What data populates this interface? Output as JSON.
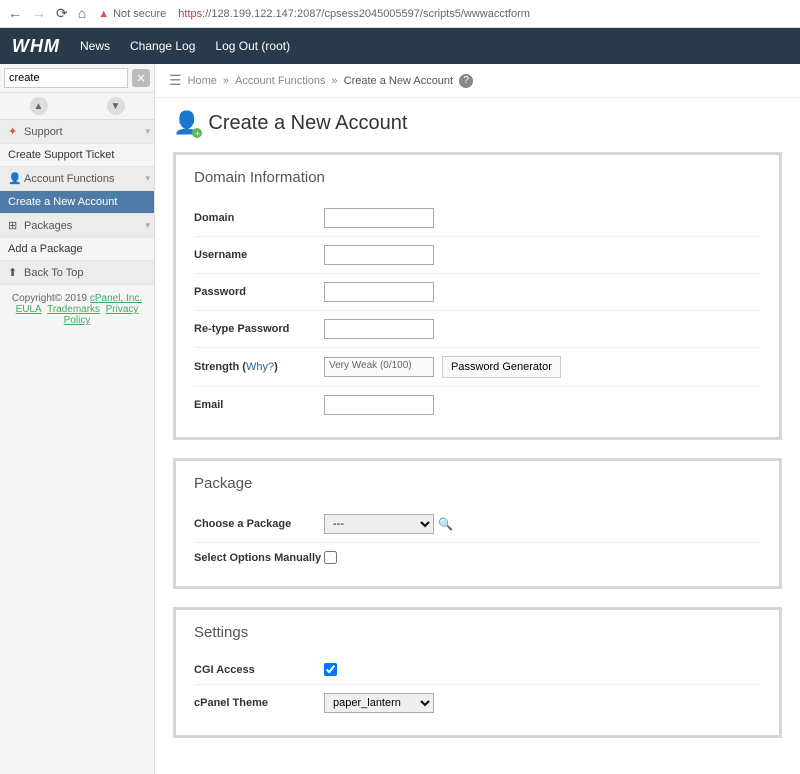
{
  "browser": {
    "not_secure": "Not secure",
    "scheme": "https",
    "url_rest": "://128.199.122.147:2087/cpsess2045005597/scripts5/wwwacctform"
  },
  "topnav": {
    "logo": "WHM",
    "news": "News",
    "changelog": "Change Log",
    "logout": "Log Out (root)"
  },
  "sidebar": {
    "search": "create",
    "items": {
      "support": "Support",
      "create_ticket": "Create Support Ticket",
      "acct_funcs": "Account Functions",
      "create_acct": "Create a New Account",
      "packages": "Packages",
      "add_package": "Add a Package",
      "back_top": "Back To Top"
    },
    "footer": {
      "copyright": "Copyright© 2019 ",
      "cpanel": "cPanel, Inc.",
      "eula": "EULA",
      "trademarks": "Trademarks",
      "privacy": "Privacy Policy"
    }
  },
  "breadcrumb": {
    "home": "Home",
    "acct_funcs": "Account Functions",
    "current": "Create a New Account"
  },
  "page": {
    "title": "Create a New Account"
  },
  "panels": {
    "domain_info": {
      "title": "Domain Information",
      "domain": "Domain",
      "username": "Username",
      "password": "Password",
      "retype": "Re-type Password",
      "strength": "Strength",
      "why": "Why?",
      "strength_value": "Very Weak (0/100)",
      "pwgen": "Password Generator",
      "email": "Email"
    },
    "package": {
      "title": "Package",
      "choose": "Choose a Package",
      "default_option": "---",
      "manual": "Select Options Manually"
    },
    "settings": {
      "title": "Settings",
      "cgi": "CGI Access",
      "theme": "cPanel Theme",
      "theme_value": "paper_lantern"
    }
  }
}
